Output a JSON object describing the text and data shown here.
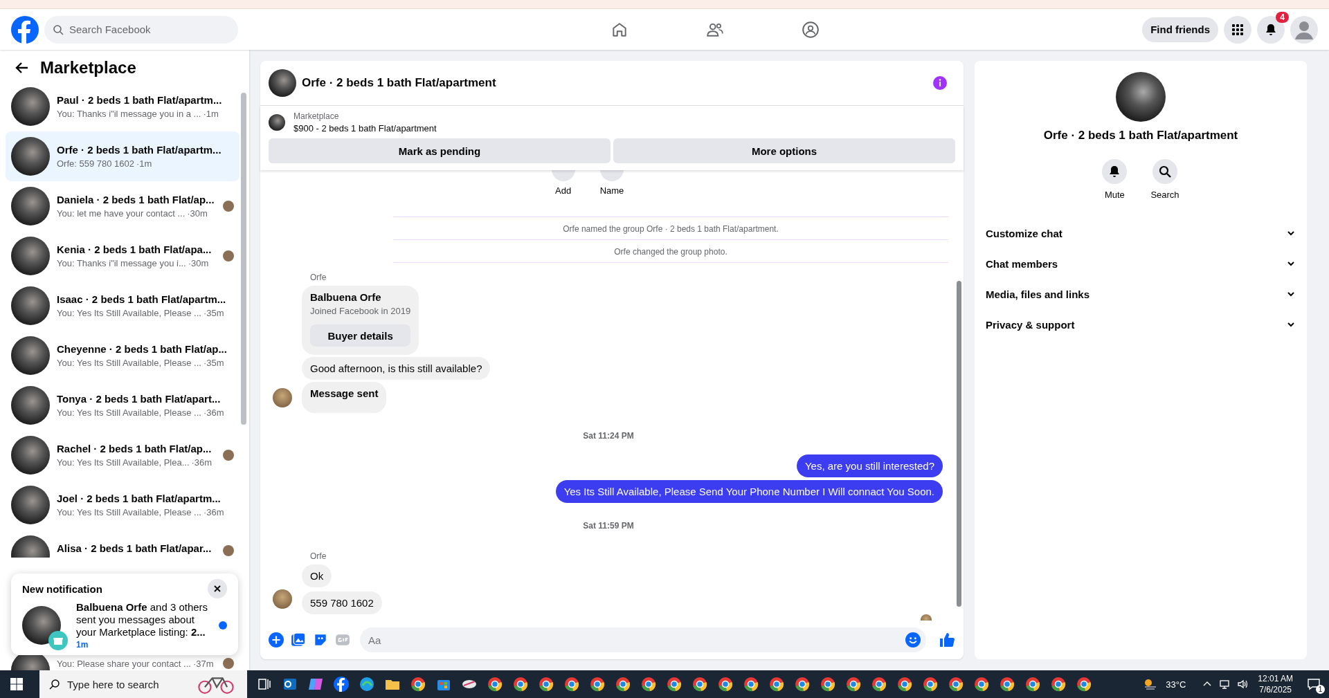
{
  "topbar": {
    "search": {
      "placeholder": "Search Facebook"
    },
    "find_friends": "Find friends",
    "notification_count": "4"
  },
  "sidebar": {
    "title": "Marketplace",
    "conversations": [
      {
        "name": "Paul · 2 beds 1 bath Flat/apartm...",
        "preview": "You: Thanks i\"il message you in a ...",
        "time": "·1m",
        "selected": false,
        "seen": false
      },
      {
        "name": "Orfe · 2 beds 1 bath Flat/apartm...",
        "preview": "Orfe: 559 780 1602",
        "time": "·1m",
        "selected": true,
        "seen": false
      },
      {
        "name": "Daniela · 2 beds 1 bath Flat/ap...",
        "preview": "You: let me have your contact ...",
        "time": "·30m",
        "selected": false,
        "seen": true
      },
      {
        "name": "Kenia · 2 beds 1 bath Flat/apa...",
        "preview": "You: Thanks i\"il message you i...",
        "time": "·30m",
        "selected": false,
        "seen": true
      },
      {
        "name": "Isaac · 2 beds 1 bath Flat/apartm...",
        "preview": "You: Yes Its Still Available, Please ...",
        "time": "·35m",
        "selected": false,
        "seen": false
      },
      {
        "name": "Cheyenne · 2 beds 1 bath Flat/ap...",
        "preview": "You: Yes Its Still Available, Please ...",
        "time": "·35m",
        "selected": false,
        "seen": false
      },
      {
        "name": "Tonya · 2 beds 1 bath Flat/apart...",
        "preview": "You: Yes Its Still Available, Please ...",
        "time": "·36m",
        "selected": false,
        "seen": false
      },
      {
        "name": "Rachel · 2 beds 1 bath Flat/ap...",
        "preview": "You: Yes Its Still Available, Plea...",
        "time": "·36m",
        "selected": false,
        "seen": true
      },
      {
        "name": "Joel · 2 beds 1 bath Flat/apartm...",
        "preview": "You: Yes Its Still Available, Please ...",
        "time": "·36m",
        "selected": false,
        "seen": false
      },
      {
        "name": "Alisa · 2 beds 1 bath Flat/apar...",
        "selected": false,
        "seen": true
      },
      {
        "preview": "You: Please share your contact ...",
        "time": "·37m",
        "selected": false,
        "seen": true
      }
    ],
    "notification": {
      "title": "New notification",
      "text": "**Balbuena Orfe** and 3 others sent you messages about your Marketplace listing: **2...**",
      "time": "1m",
      "unread": true
    }
  },
  "chat": {
    "title": "Orfe · 2 beds 1 bath Flat/apartment",
    "listing": {
      "label": "Marketplace",
      "item": "$900 - 2 beds 1 bath Flat/apartment"
    },
    "actions": [
      "Mark as pending",
      "More options"
    ],
    "quick_actions": [
      "Add",
      "Name"
    ],
    "messages": [
      {
        "kind": "system",
        "text": "Orfe named the group Orfe · 2 beds 1 bath Flat/apartment."
      },
      {
        "kind": "system",
        "text": "Orfe changed the group photo."
      },
      {
        "kind": "sender",
        "text": "Orfe"
      },
      {
        "kind": "profile",
        "name": "Balbuena Orfe",
        "sub": "Joined Facebook in 2019",
        "button": "Buyer details"
      },
      {
        "kind": "incoming",
        "text": "Good afternoon, is this still available?",
        "avatar": false,
        "bold": false
      },
      {
        "kind": "incoming",
        "text": "Message sent",
        "avatar": true,
        "bold": true
      },
      {
        "kind": "timestamp",
        "text": "Sat 11:24 PM"
      },
      {
        "kind": "outgoing",
        "text": "Yes, are you still interested?"
      },
      {
        "kind": "outgoing",
        "text": "Yes Its Still Available, Please Send Your Phone Number I Will connact You Soon."
      },
      {
        "kind": "timestamp",
        "text": "Sat 11:59 PM"
      },
      {
        "kind": "sender",
        "text": "Orfe"
      },
      {
        "kind": "incoming",
        "text": "Ok",
        "avatar": false,
        "bold": false
      },
      {
        "kind": "incoming",
        "text": "559 780 1602",
        "avatar": true,
        "bold": false
      }
    ],
    "composer": {
      "placeholder": "Aa"
    }
  },
  "details": {
    "title": "Orfe · 2 beds 1 bath Flat/apartment",
    "actions": [
      {
        "kind": "mute",
        "label": "Mute"
      },
      {
        "kind": "search",
        "label": "Search"
      }
    ],
    "sections": [
      "Customize chat",
      "Chat members",
      "Media, files and links",
      "Privacy & support"
    ]
  },
  "taskbar": {
    "search": {
      "placeholder": "Type here to search"
    },
    "weather": "33°C",
    "time": "12:01 AM",
    "date": "7/6/2025",
    "notification_count": "1"
  }
}
